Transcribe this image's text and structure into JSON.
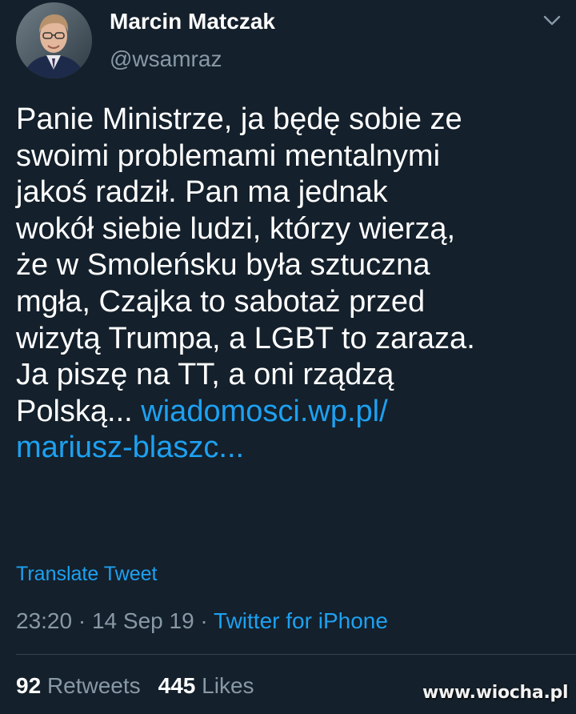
{
  "tweet": {
    "author": {
      "display_name": "Marcin Matczak",
      "handle": "@wsamraz"
    },
    "text_lines": [
      "Panie Ministrze, ja będę sobie ze",
      "swoimi problemami mentalnymi",
      "jakoś radził. Pan ma jednak",
      "wokół siebie ludzi, którzy wierzą,",
      "że w Smoleńsku była sztuczna",
      "mgła, Czajka to sabotaż przed",
      "wizytą Trumpa, a LGBT to zaraza.",
      "Ja piszę na TT, a oni rządzą",
      "Polską... "
    ],
    "link_line1": "wiadomosci.wp.pl/",
    "link_line2": "mariusz-blaszc...",
    "translate_label": "Translate Tweet",
    "time": "23:20",
    "date": "14 Sep 19",
    "separator": " · ",
    "source": "Twitter for iPhone",
    "retweets_count": "92",
    "retweets_label": "Retweets",
    "likes_count": "445",
    "likes_label": "Likes"
  },
  "watermark": "www.wiocha.pl",
  "icons": {
    "menu": "chevron-down-icon",
    "avatar": "avatar-photo"
  },
  "colors": {
    "background": "#14202b",
    "text": "#ffffff",
    "secondary": "#8899a6",
    "accent": "#1da1f2",
    "divider": "#38444d"
  }
}
